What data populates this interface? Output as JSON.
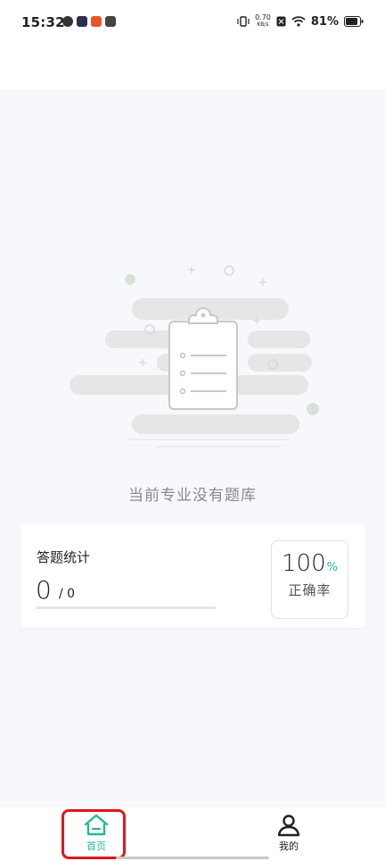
{
  "status_bar": {
    "time": "15:32",
    "net_speed_value": "0.70",
    "net_speed_unit": "KB/s",
    "battery": "81%"
  },
  "empty_state": {
    "message": "当前专业没有题库",
    "icon": "clipboard-list-icon"
  },
  "stats": {
    "title": "答题统计",
    "answered": "0",
    "total": "/ 0",
    "progress": 0,
    "accuracy_value": "100",
    "accuracy_unit": "%",
    "accuracy_label": "正确率"
  },
  "nav": {
    "home_label": "首页",
    "mine_label": "我的",
    "active": "home"
  },
  "colors": {
    "accent": "#22b79a",
    "highlight": "#e0161d",
    "background": "#f7f8fc"
  }
}
